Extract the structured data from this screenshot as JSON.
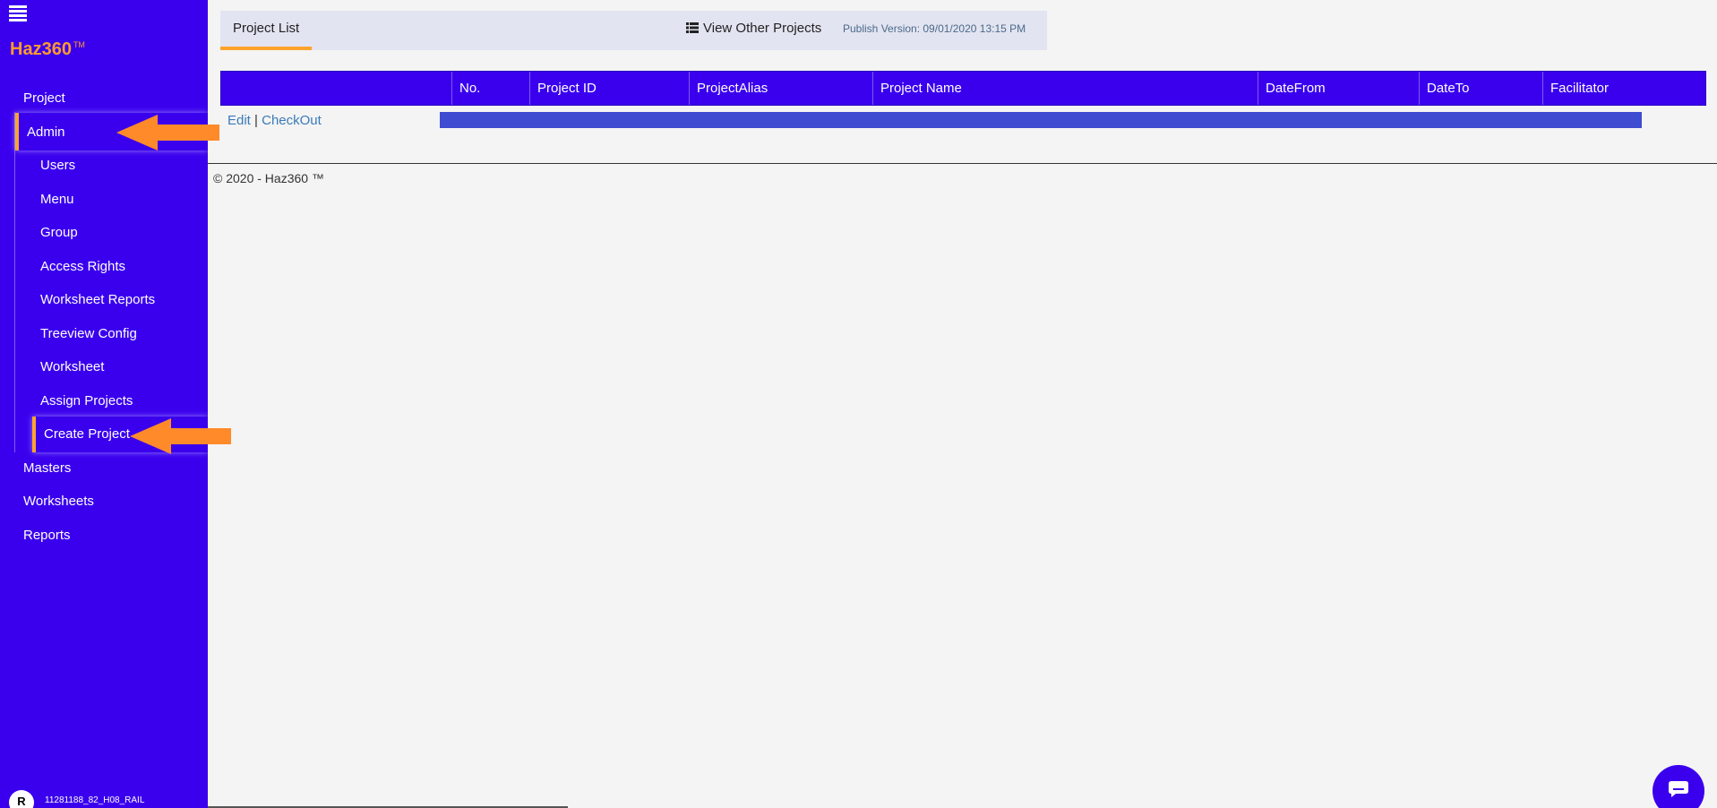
{
  "brand": {
    "name": "Haz360",
    "tm": "TM"
  },
  "sidebar": {
    "items": [
      {
        "label": "Project"
      },
      {
        "label": "Admin"
      },
      {
        "label": "Masters"
      },
      {
        "label": "Worksheets"
      },
      {
        "label": "Reports"
      }
    ],
    "admin_children": [
      {
        "label": "Users"
      },
      {
        "label": "Menu"
      },
      {
        "label": "Group"
      },
      {
        "label": "Access Rights"
      },
      {
        "label": "Worksheet Reports"
      },
      {
        "label": "Treeview Config"
      },
      {
        "label": "Worksheet"
      },
      {
        "label": "Assign Projects"
      },
      {
        "label": "Create Project"
      }
    ],
    "user": {
      "initial": "R",
      "code": "11281188_82_H08_RAIL"
    }
  },
  "tabbar": {
    "active_tab": "Project List",
    "view_other": "View Other Projects",
    "publish": "Publish Version: 09/01/2020 13:15 PM"
  },
  "table": {
    "columns": [
      "",
      "No.",
      "Project ID",
      "ProjectAlias",
      "Project Name",
      "DateFrom",
      "DateTo",
      "Facilitator"
    ],
    "row_actions": {
      "edit": "Edit",
      "sep": "|",
      "checkout": "CheckOut"
    }
  },
  "footer": "© 2020 - Haz360 ™",
  "colors": {
    "primary": "#3a00ee",
    "accent": "#ff9a2e",
    "link": "#3a7ab8"
  },
  "icons": [
    "hamburger-icon",
    "list-icon",
    "chat-icon",
    "arrow-left-icon"
  ]
}
